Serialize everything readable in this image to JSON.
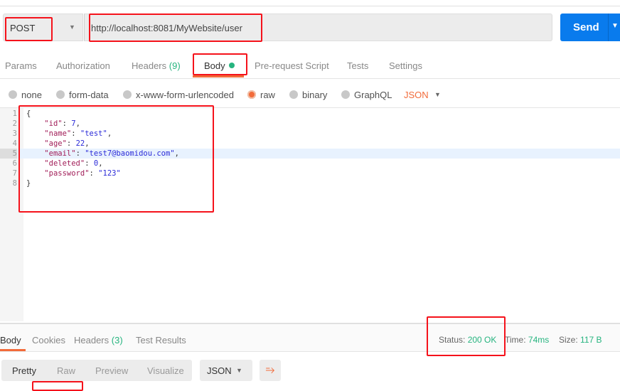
{
  "request": {
    "method": "POST",
    "url": "http://localhost:8081/MyWebsite/user",
    "send_label": "Send"
  },
  "tabs": [
    {
      "label": "Params"
    },
    {
      "label": "Authorization"
    },
    {
      "label": "Headers",
      "count": "(9)"
    },
    {
      "label": "Body",
      "active": true
    },
    {
      "label": "Pre-request Script"
    },
    {
      "label": "Tests"
    },
    {
      "label": "Settings"
    }
  ],
  "body_types": [
    "none",
    "form-data",
    "x-www-form-urlencoded",
    "raw",
    "binary",
    "GraphQL"
  ],
  "body_selected": "raw",
  "body_format": "JSON",
  "code_lines": [
    {
      "num": "1",
      "text": "{"
    },
    {
      "num": "2",
      "key": "\"id\"",
      "value": "7",
      "trail": ","
    },
    {
      "num": "3",
      "key": "\"name\"",
      "value": "\"test\"",
      "trail": ","
    },
    {
      "num": "4",
      "key": "\"age\"",
      "value": "22",
      "trail": ","
    },
    {
      "num": "5",
      "key": "\"email\"",
      "value": "\"test7@baomidou.com\"",
      "trail": ","
    },
    {
      "num": "6",
      "key": "\"deleted\"",
      "value": "0",
      "trail": ","
    },
    {
      "num": "7",
      "key": "\"password\"",
      "value": "\"123\"",
      "trail": ""
    },
    {
      "num": "8",
      "text": "}"
    }
  ],
  "response": {
    "tabs": [
      {
        "label": "Body"
      },
      {
        "label": "Cookies"
      },
      {
        "label": "Headers",
        "count": "(3)"
      },
      {
        "label": "Test Results"
      }
    ],
    "status_label": "Status:",
    "status": "200 OK",
    "time_label": "Time:",
    "time": "74ms",
    "size_label": "Size:",
    "size": "117 B",
    "views": [
      "Pretty",
      "Raw",
      "Preview",
      "Visualize"
    ],
    "format": "JSON"
  },
  "colors": {
    "accent": "#f26b3a",
    "send": "#097bed",
    "success": "#26b47f",
    "annotation": "#f5121b"
  }
}
